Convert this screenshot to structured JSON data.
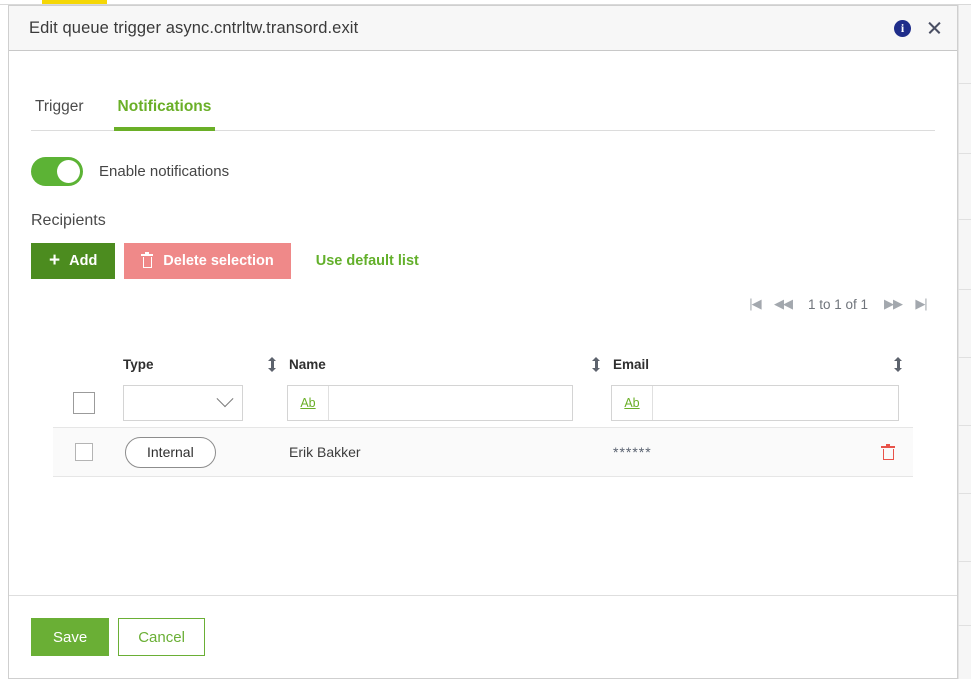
{
  "dialog": {
    "title": "Edit queue trigger async.cntrltw.transord.exit",
    "info_icon": "info-icon",
    "close_icon": "close-icon"
  },
  "tabs": [
    {
      "label": "Trigger",
      "active": false
    },
    {
      "label": "Notifications",
      "active": true
    }
  ],
  "notifications": {
    "toggle_label": "Enable notifications",
    "toggle_state": "on"
  },
  "recipients": {
    "section_title": "Recipients",
    "add_label": "Add",
    "add_icon": "plus-icon",
    "delete_label": "Delete selection",
    "delete_icon": "trash-icon",
    "default_list_label": "Use default list"
  },
  "pager": {
    "first_icon": "first-page-icon",
    "prev_icon": "previous-page-icon",
    "label": "1 to 1 of 1",
    "next_icon": "next-page-icon",
    "last_icon": "last-page-icon"
  },
  "table": {
    "columns": [
      {
        "key": "type",
        "label": "Type",
        "sort_icon": "sort-icon"
      },
      {
        "key": "name",
        "label": "Name",
        "sort_icon": "sort-icon"
      },
      {
        "key": "email",
        "label": "Email",
        "sort_icon": "sort-icon"
      }
    ],
    "filters": {
      "type_value": "",
      "name_value": "",
      "name_prefix": "Ab",
      "email_value": "",
      "email_prefix": "Ab"
    },
    "rows": [
      {
        "selected": false,
        "type": "Internal",
        "name": "Erik Bakker",
        "email": "******",
        "delete_icon": "trash-icon"
      }
    ]
  },
  "footer": {
    "save_label": "Save",
    "cancel_label": "Cancel"
  },
  "colors": {
    "accent_green": "#6aaf27",
    "toggle_green": "#5cb335",
    "add_green": "#4c8c1f",
    "delete_salmon": "#ef8989",
    "save_green": "#6aaf35",
    "info_blue": "#1f2d8a",
    "row_trash_red": "#e8534a",
    "top_bar_yellow": "#f5d706"
  }
}
